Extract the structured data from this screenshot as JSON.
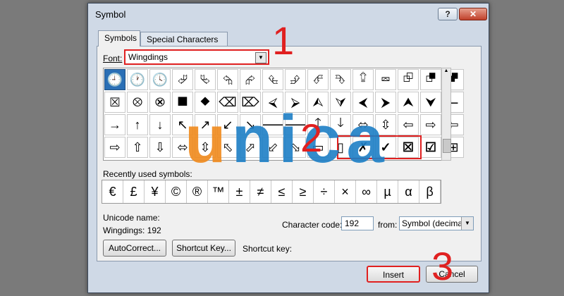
{
  "window": {
    "title": "Symbol",
    "help_label": "?",
    "close_label": "✕"
  },
  "tabs": [
    {
      "label": "Symbols",
      "active": true
    },
    {
      "label": "Special Characters",
      "active": false
    }
  ],
  "font": {
    "label": "Font:",
    "value": "Wingdings"
  },
  "symbol_grid": [
    [
      "🕘",
      "🕐",
      "🕓",
      "⮰",
      "⮱",
      "⮲",
      "⮳",
      "⮴",
      "⮵",
      "⮶",
      "⮷",
      "⮸",
      "⮹",
      "⮺",
      "⮻",
      "⮼"
    ],
    [
      "⮽",
      "⮾",
      "⮿",
      "⯀",
      "⯁",
      "⌫",
      "⌦",
      "⮘",
      "⮚",
      "⮙",
      "⮛",
      "⮜",
      "⮞",
      "⮝",
      "⮟",
      "⭠"
    ],
    [
      "→",
      "↑",
      "↓",
      "↖",
      "↗",
      "↙",
      "↘",
      "🡐",
      "🡒",
      "🡑",
      "🡓",
      "⬄",
      "⇳",
      "⇦",
      "⇨",
      "⇦"
    ],
    [
      "⇨",
      "⇧",
      "⇩",
      "⬄",
      "⇳",
      "⬁",
      "⬀",
      "⬃",
      "⬂",
      "▭",
      "▯",
      "✗",
      "✓",
      "☒",
      "☑",
      "⊞"
    ]
  ],
  "selected_cell": "0-0",
  "highlighted_cells": [
    "3-12",
    "3-13",
    "3-14"
  ],
  "recent": {
    "label": "Recently used symbols:",
    "symbols": [
      "€",
      "£",
      "¥",
      "©",
      "®",
      "™",
      "±",
      "≠",
      "≤",
      "≥",
      "÷",
      "×",
      "∞",
      "µ",
      "α",
      "β"
    ]
  },
  "unicode": {
    "name_label": "Unicode name:",
    "value": "Wingdings: 192"
  },
  "char_code": {
    "label": "Character code:",
    "value": "192"
  },
  "from": {
    "label": "from:",
    "value": "Symbol (decimal)"
  },
  "buttons": {
    "autocorrect": "AutoCorrect...",
    "shortcut_key": "Shortcut Key...",
    "insert": "Insert",
    "cancel": "Cancel"
  },
  "shortcut_key_label": "Shortcut key:",
  "annotations": {
    "step1": "1",
    "step2": "2",
    "step3": "3"
  },
  "watermark": {
    "first": "u",
    "rest": "nica"
  },
  "colors": {
    "annotation_red": "#e02020",
    "watermark_orange": "#f08a1c",
    "watermark_blue": "#1d7fc6",
    "selection_blue": "#2a6fb5"
  }
}
